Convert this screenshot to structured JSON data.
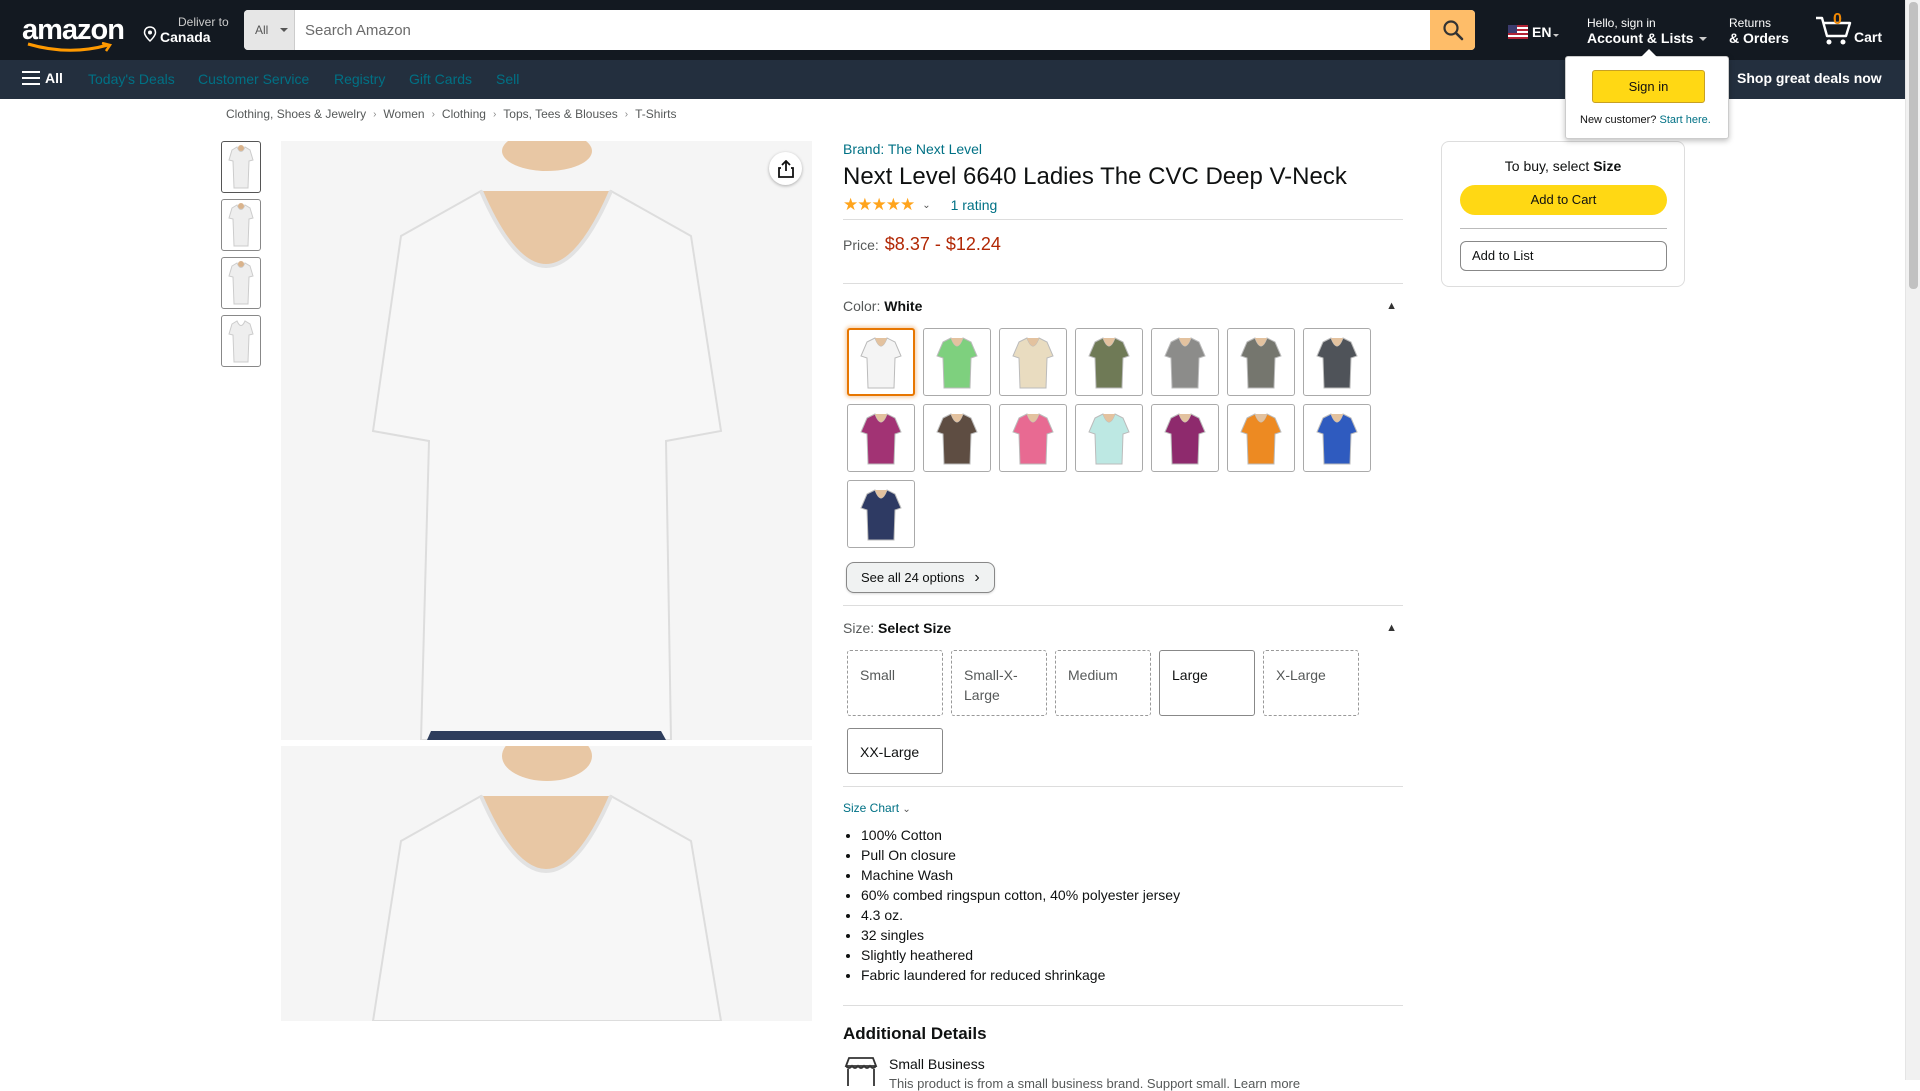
{
  "nav": {
    "logo_text": "amazon",
    "deliver_line1": "Deliver to",
    "deliver_line2": "Canada",
    "search_category": "All",
    "search_placeholder": "Search Amazon",
    "lang": "EN",
    "account_line1": "Hello, sign in",
    "account_line2": "Account & Lists",
    "returns_line1": "Returns",
    "returns_line2": "& Orders",
    "cart_count": "0",
    "cart_label": "Cart"
  },
  "subnav": {
    "all_label": "All",
    "items": [
      "Today's Deals",
      "Customer Service",
      "Registry",
      "Gift Cards",
      "Sell"
    ],
    "promo": "Shop great deals now"
  },
  "flyout": {
    "signin_label": "Sign in",
    "new_customer": "New customer?",
    "start_here": "Start here."
  },
  "breadcrumb": [
    "Clothing, Shoes & Jewelry",
    "Women",
    "Clothing",
    "Tops, Tees & Blouses",
    "T-Shirts"
  ],
  "product": {
    "brand": "Brand: The Next Level",
    "title": "Next Level 6640 Ladies The CVC Deep V-Neck",
    "stars": "★★★★★",
    "rating_count": "1 rating",
    "price_label": "Price:",
    "price_value": "$8.37 - $12.24",
    "color_label": "Color:",
    "color_value": "White",
    "see_all": "See all 24 options",
    "size_label": "Size:",
    "size_value": "Select Size",
    "sizes": [
      "Small",
      "Small-X-Large",
      "Medium",
      "Large",
      "X-Large",
      "XX-Large"
    ],
    "size_chart": "Size Chart",
    "bullets": [
      "100% Cotton",
      "Pull On closure",
      "Machine Wash",
      "60% combed ringspun cotton, 40% polyester jersey",
      "4.3 oz.",
      "32 singles",
      "Slightly heathered",
      "Fabric laundered for reduced shrinkage"
    ],
    "additional_details": "Additional Details",
    "small_business": "Small Business",
    "small_business_sub": "This product is from a small business brand. Support small. Learn more"
  },
  "colors": [
    "#f4f4f4",
    "#7ed07e",
    "#e9dcc0",
    "#6f7a56",
    "#8c8c8a",
    "#75766e",
    "#4f5359",
    "#a23374",
    "#5e4d42",
    "#e86a92",
    "#bde8e3",
    "#8e2a6d",
    "#ed8a22",
    "#2f5bbf",
    "#2e3a63"
  ],
  "buybox": {
    "heading_prefix": "To buy, select",
    "heading_bold": "Size",
    "add_to_cart": "Add to Cart",
    "add_to_list": "Add to List"
  },
  "accent": {
    "nav_bg": "#131921",
    "subnav_bg": "#232F3E",
    "price": "#B12704",
    "link": "#007185",
    "button": "#FFD814",
    "search_btn": "#FEBD69"
  }
}
